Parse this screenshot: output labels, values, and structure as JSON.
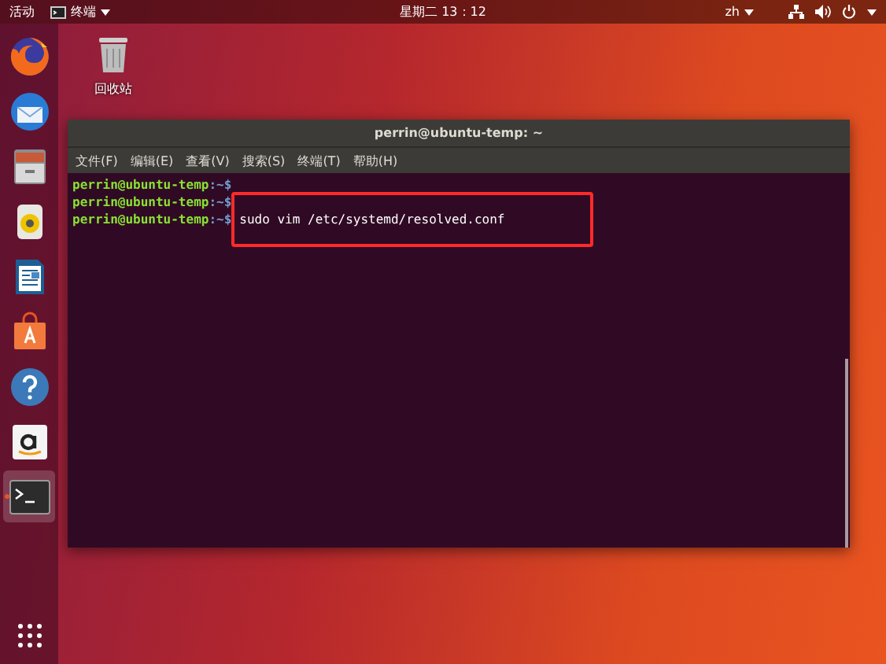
{
  "top_bar": {
    "activities": "活动",
    "app_menu": "终端",
    "clock": "星期二 13：12",
    "input_method": "zh"
  },
  "dock": [
    {
      "kind": "firefox",
      "active": false
    },
    {
      "kind": "mail",
      "active": false
    },
    {
      "kind": "files",
      "active": false
    },
    {
      "kind": "music",
      "active": false
    },
    {
      "kind": "writer",
      "active": false
    },
    {
      "kind": "software",
      "active": false
    },
    {
      "kind": "help",
      "active": false
    },
    {
      "kind": "amazon",
      "active": false
    },
    {
      "kind": "terminal",
      "active": true
    }
  ],
  "desktop_icons": [
    {
      "label": "回收站"
    }
  ],
  "terminal": {
    "title": "perrin@ubuntu-temp: ~",
    "menu": [
      "文件(F)",
      "编辑(E)",
      "查看(V)",
      "搜索(S)",
      "终端(T)",
      "帮助(H)"
    ],
    "lines": [
      {
        "prompt": "perrin@ubuntu-temp",
        "path": ":~$",
        "highlighted": false
      },
      {
        "prompt": "perrin@ubuntu-temp",
        "path": ":~$",
        "highlighted": false
      },
      {
        "prompt": "perrin@ubuntu-temp",
        "path": ":~$",
        "command": "sudo vim /etc/systemd/resolved.conf",
        "highlighted": true
      }
    ]
  }
}
